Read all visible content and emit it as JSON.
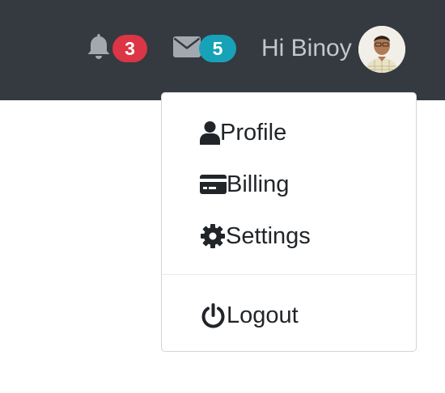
{
  "navbar": {
    "background": "#343a40",
    "notifications": {
      "icon": "bell-icon",
      "count": "3",
      "badge_color": "#dc3545"
    },
    "messages": {
      "icon": "envelope-icon",
      "count": "5",
      "badge_color": "#17a2b8"
    },
    "greeting": "Hi Binoy",
    "avatar": "user-avatar-photo"
  },
  "menu": {
    "items": [
      {
        "label": "Profile",
        "icon": "user-icon"
      },
      {
        "label": "Billing",
        "icon": "credit-card-icon"
      },
      {
        "label": "Settings",
        "icon": "gear-icon"
      },
      {
        "label": "Logout",
        "icon": "power-icon"
      }
    ]
  }
}
